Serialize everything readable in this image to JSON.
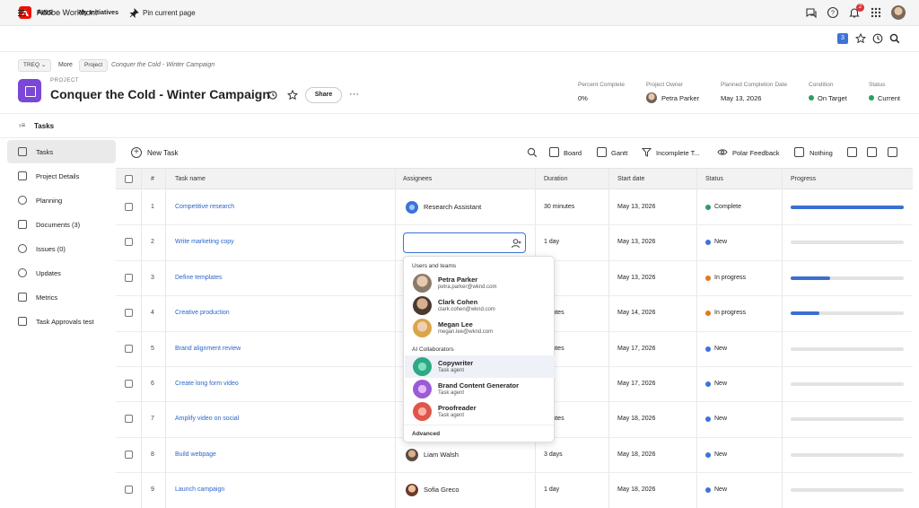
{
  "app": {
    "title": "Adobe Workfront",
    "notification_count": "2"
  },
  "pins": {
    "label": "PINS",
    "my_initiatives": "My Initiatives",
    "pin_current": "Pin current page",
    "count": "3"
  },
  "breadcrumb": {
    "treq": "TREQ",
    "more": "More",
    "project": "Project",
    "current": "Conquer the Cold - Winter Campaign"
  },
  "project": {
    "kind": "PROJECT",
    "title": "Conquer the Cold - Winter Campaign",
    "share_label": "Share",
    "more_label": "···",
    "meta": {
      "percent_label": "Percent Complete",
      "percent_value": "0%",
      "owner_label": "Project Owner",
      "owner_value": "Petra Parker",
      "planned_label": "Planned Completion Date",
      "planned_value": "May 13, 2026",
      "condition_label": "Condition",
      "condition_value": "On Target",
      "status_label": "Status",
      "status_value": "Current"
    }
  },
  "section": {
    "tasks_label": "Tasks"
  },
  "sidebar": {
    "items": [
      {
        "label": "Tasks"
      },
      {
        "label": "Project Details"
      },
      {
        "label": "Planning"
      },
      {
        "label": "Documents (3)"
      },
      {
        "label": "Issues (0)"
      },
      {
        "label": "Updates"
      },
      {
        "label": "Metrics"
      },
      {
        "label": "Task Approvals test"
      }
    ]
  },
  "toolbar": {
    "new_task": "New Task",
    "board": "Board",
    "gantt": "Gantt",
    "filter": "Incomplete T...",
    "view": "Polar Feedback",
    "group": "Nothing"
  },
  "table": {
    "headers": {
      "num": "#",
      "name": "Task name",
      "assignees": "Assignees",
      "duration": "Duration",
      "start": "Start date",
      "status": "Status",
      "progress": "Progress"
    },
    "rows": [
      {
        "num": "1",
        "name": "Competitive research",
        "assignee": "Research Assistant",
        "duration": "30 minutes",
        "start": "May 13, 2026",
        "status": "Complete",
        "progress": 1.0
      },
      {
        "num": "2",
        "name": "Write marketing copy",
        "assignee": "",
        "duration": "1 day",
        "start": "May 13, 2026",
        "status": "New",
        "progress": 0
      },
      {
        "num": "3",
        "name": "Define templates",
        "assignee": "",
        "duration": "ys",
        "start": "May 13, 2026",
        "status": "In progress",
        "progress": 0.35
      },
      {
        "num": "4",
        "name": "Creative production",
        "assignee": "",
        "duration": "ninutes",
        "start": "May 14, 2026",
        "status": "In progress",
        "progress": 0.25
      },
      {
        "num": "5",
        "name": "Brand alignment review",
        "assignee": "",
        "duration": "ninutes",
        "start": "May 17, 2026",
        "status": "New",
        "progress": 0
      },
      {
        "num": "6",
        "name": "Create long form video",
        "assignee": "",
        "duration": "ys",
        "start": "May 17, 2026",
        "status": "New",
        "progress": 0
      },
      {
        "num": "7",
        "name": "Amplify video on social",
        "assignee": "",
        "duration": "ninutes",
        "start": "May 18, 2026",
        "status": "New",
        "progress": 0
      },
      {
        "num": "8",
        "name": "Build webpage",
        "assignee": "Liam Walsh",
        "duration": "3 days",
        "start": "May 18, 2026",
        "status": "New",
        "progress": 0
      },
      {
        "num": "9",
        "name": "Launch campaign",
        "assignee": "Sofia Greco",
        "duration": "1 day",
        "start": "May 18, 2026",
        "status": "New",
        "progress": 0
      }
    ]
  },
  "dropdown": {
    "users_heading": "Users and teams",
    "users": [
      {
        "name": "Petra Parker",
        "sub": "petra.parker@wknd.com"
      },
      {
        "name": "Clark Cohen",
        "sub": "clark.cohen@wknd.com"
      },
      {
        "name": "Megan Lee",
        "sub": "megan.lee@wknd.com"
      }
    ],
    "ai_heading": "AI Collaborators",
    "ai": [
      {
        "name": "Copywriter",
        "sub": "Task agent"
      },
      {
        "name": "Brand Content Generator",
        "sub": "Task agent"
      },
      {
        "name": "Proofreader",
        "sub": "Task agent"
      }
    ],
    "advanced": "Advanced"
  },
  "colors": {
    "brand": "#eb1000",
    "accent": "#3d73d7",
    "link": "#2b66c9",
    "complete": "#2d9d63",
    "new": "#3d73d7",
    "in_progress": "#e07a1f",
    "on_target": "#2d9d63",
    "project_icon": "#7b47d6"
  }
}
